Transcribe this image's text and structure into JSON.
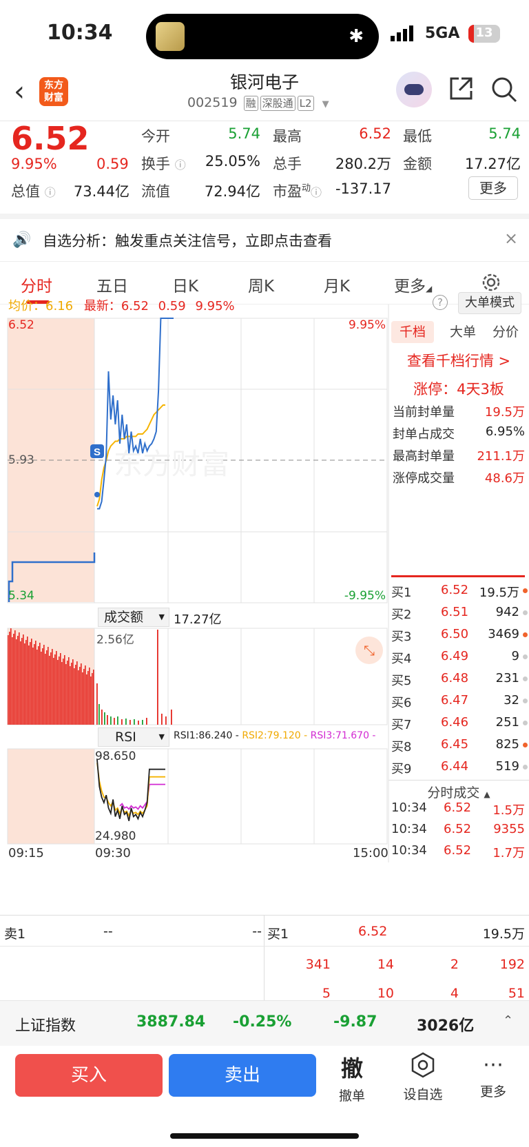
{
  "status": {
    "time": "10:34",
    "network": "5GA",
    "battery": "13"
  },
  "header": {
    "title": "银河电子",
    "code": "002519",
    "tags": [
      "融",
      "深股通",
      "L2"
    ],
    "logo_line1": "东方",
    "logo_line2": "财富"
  },
  "quote": {
    "price": "6.52",
    "pct": "9.95%",
    "chg": "0.59",
    "open_label": "今开",
    "open": "5.74",
    "high_label": "最高",
    "high": "6.52",
    "low_label": "最低",
    "low": "5.74",
    "turnover_label": "换手",
    "turnover": "25.05%",
    "volume_label": "总手",
    "volume": "280.2万",
    "amount_label": "金额",
    "amount": "17.27亿",
    "mktcap_label": "总值",
    "mktcap": "73.44亿",
    "float_label": "流值",
    "float": "72.94亿",
    "pe_label": "市盈",
    "pe_sup": "动",
    "pe": "-137.17",
    "more": "更多"
  },
  "notice": {
    "text": "自选分析：触发重点关注信号，立即点击查看"
  },
  "tabs": [
    "分时",
    "五日",
    "日K",
    "周K",
    "月K",
    "更多"
  ],
  "chart": {
    "avg_label": "均价：",
    "avg": "6.16",
    "latest_label": "最新：",
    "latest": "6.52",
    "latest_chg": "0.59",
    "latest_pct": "9.95%",
    "bigorder": "大单模式",
    "y_top": "6.52",
    "y_mid": "5.93",
    "y_bot": "5.34",
    "pct_top": "9.95%",
    "pct_bot": "-9.95%",
    "watermark": "东方财富",
    "s_mark": "S",
    "vol_selector": "成交额",
    "vol_total": "17.27亿",
    "vol_max": "2.56亿",
    "rsi_selector": "RSI",
    "rsi1": "RSI1:86.240 -",
    "rsi2": "RSI2:79.120 -",
    "rsi3": "RSI3:71.670 -",
    "rsi_top": "98.650",
    "rsi_bot": "24.980",
    "t_start": "09:15",
    "t_open": "09:30",
    "t_end": "15:00",
    "price_series": [
      5.73,
      5.73,
      5.76,
      5.85,
      5.95,
      6.3,
      6.1,
      6.2,
      6.08,
      6.18,
      6.0,
      6.12,
      6.02,
      6.08,
      5.96,
      6.05,
      5.97,
      5.99,
      5.96,
      6.02,
      5.96,
      6.0,
      5.97,
      5.99,
      6.0,
      6.02,
      6.05,
      6.22,
      6.52,
      6.52,
      6.52
    ],
    "avg_series": [
      5.74,
      5.77,
      5.85,
      5.9,
      5.93,
      5.97,
      5.99,
      6.0,
      6.01,
      6.01,
      6.02,
      6.02,
      6.02,
      6.03,
      6.03,
      6.03,
      6.03,
      6.03,
      6.04,
      6.04,
      6.04,
      6.05,
      6.06,
      6.08,
      6.1,
      6.12,
      6.13,
      6.14,
      6.15,
      6.16,
      6.16
    ]
  },
  "right": {
    "tabs": [
      "千档",
      "大单",
      "分价"
    ],
    "link": "查看千档行情 >",
    "limit": "涨停：4天3板",
    "stats": [
      {
        "label": "当前封单量",
        "value": "19.5万"
      },
      {
        "label": "封单占成交",
        "value": "6.95%"
      },
      {
        "label": "最高封单量",
        "value": "211.1万"
      },
      {
        "label": "涨停成交量",
        "value": "48.6万"
      }
    ],
    "bids": [
      {
        "label": "买1",
        "price": "6.52",
        "vol": "19.5万"
      },
      {
        "label": "买2",
        "price": "6.51",
        "vol": "942"
      },
      {
        "label": "买3",
        "price": "6.50",
        "vol": "3469"
      },
      {
        "label": "买4",
        "price": "6.49",
        "vol": "9"
      },
      {
        "label": "买5",
        "price": "6.48",
        "vol": "231"
      },
      {
        "label": "买6",
        "price": "6.47",
        "vol": "32"
      },
      {
        "label": "买7",
        "price": "6.46",
        "vol": "251"
      },
      {
        "label": "买8",
        "price": "6.45",
        "vol": "825"
      },
      {
        "label": "买9",
        "price": "6.44",
        "vol": "519"
      }
    ],
    "ticks_title": "分时成交",
    "ticks": [
      {
        "time": "10:34",
        "price": "6.52",
        "vol": "1.5万"
      },
      {
        "time": "10:34",
        "price": "6.52",
        "vol": "9355"
      },
      {
        "time": "10:34",
        "price": "6.52",
        "vol": "1.7万"
      }
    ]
  },
  "orderbook": {
    "ask_label": "卖1",
    "ask_price": "--",
    "ask_vol": "--",
    "bid_label": "买1",
    "bid_price": "6.52",
    "bid_vol": "19.5万",
    "row1": [
      "341",
      "14",
      "2",
      "192"
    ],
    "row2": [
      "5",
      "10",
      "4",
      "51"
    ]
  },
  "index": {
    "name": "上证指数",
    "value": "3887.84",
    "pct": "-0.25%",
    "chg": "-9.87",
    "amount": "3026亿"
  },
  "trade": {
    "buy": "买入",
    "sell": "卖出",
    "cancel_icon": "撤",
    "cancel": "撤单",
    "watch": "设自选",
    "more": "更多"
  }
}
